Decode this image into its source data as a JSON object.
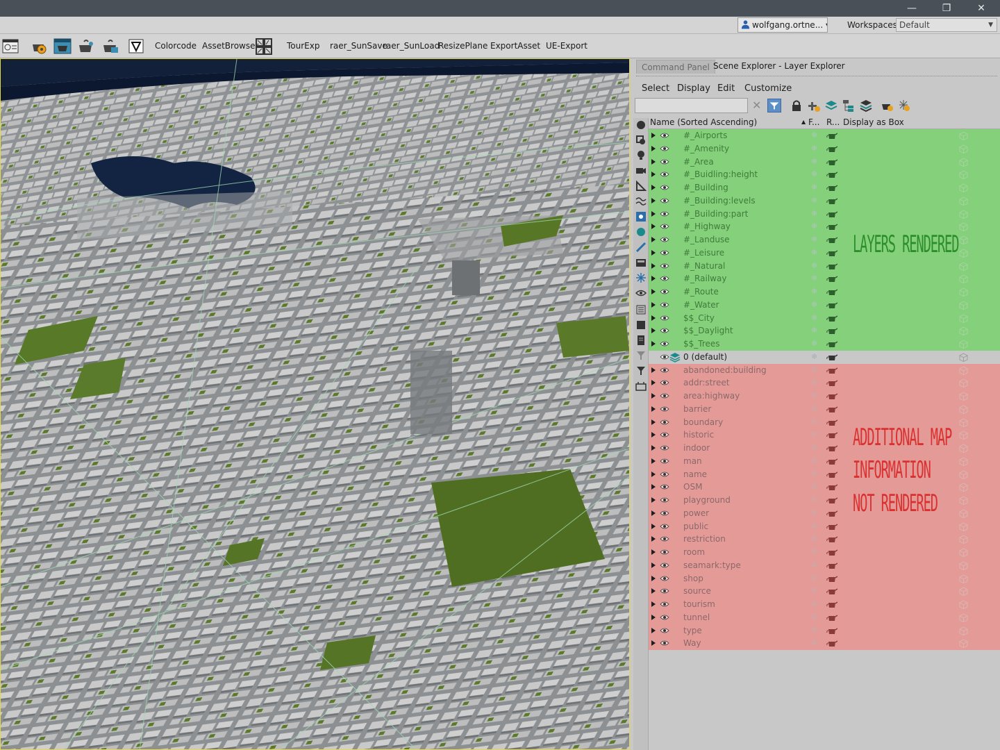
{
  "window": {
    "controls": {
      "minimize": "—",
      "restore": "❐",
      "close": "✕"
    }
  },
  "account": {
    "user_label": "wolfgang.ortne...",
    "workspaces_label": "Workspaces:",
    "workspace_value": "Default"
  },
  "toolbar": {
    "buttons": [
      "Colorcode",
      "AssetBrowser",
      "TourExp",
      "raer_SunSave",
      "raer_SunLoad",
      "ResizePlane",
      "ExportAsset",
      "UE-Export"
    ]
  },
  "panel": {
    "tabs": {
      "command": "Command Panel",
      "scene": "Scene Explorer - Layer Explorer"
    },
    "menu": {
      "select": "Select",
      "display": "Display",
      "edit": "Edit",
      "customize": "Customize"
    },
    "search_placeholder": "",
    "columns": {
      "name": "Name (Sorted Ascending)",
      "sort_marker": "▲",
      "frozen": "F...",
      "render": "R...",
      "display_box": "Display as Box"
    }
  },
  "layers_rendered": [
    "#_Airports",
    "#_Amenity",
    "#_Area",
    "#_Buidling:height",
    "#_Building",
    "#_Building:levels",
    "#_Building:part",
    "#_Highway",
    "#_Landuse",
    "#_Leisure",
    "#_Natural",
    "#_Railway",
    "#_Route",
    "#_Water",
    "$$_City",
    "$$_Daylight",
    "$$_Trees"
  ],
  "layer_default": "0 (default)",
  "layers_not_rendered": [
    "abandoned:building",
    "addr:street",
    "area:highway",
    "barrier",
    "boundary",
    "historic",
    "indoor",
    "man",
    "name",
    "OSM",
    "playground",
    "power",
    "public",
    "restriction",
    "room",
    "seamark:type",
    "shop",
    "source",
    "tourism",
    "tunnel",
    "type",
    "Way"
  ],
  "annotations": {
    "rendered": "LAYERS RENDERED",
    "not_rendered_1": "ADDITIONAL MAP",
    "not_rendered_2": "INFORMATION",
    "not_rendered_3": "NOT RENDERED"
  },
  "colors": {
    "rendered_bg": "#85d17b",
    "not_rendered_bg": "#e49b98",
    "viewport_border": "#e5d84a"
  }
}
